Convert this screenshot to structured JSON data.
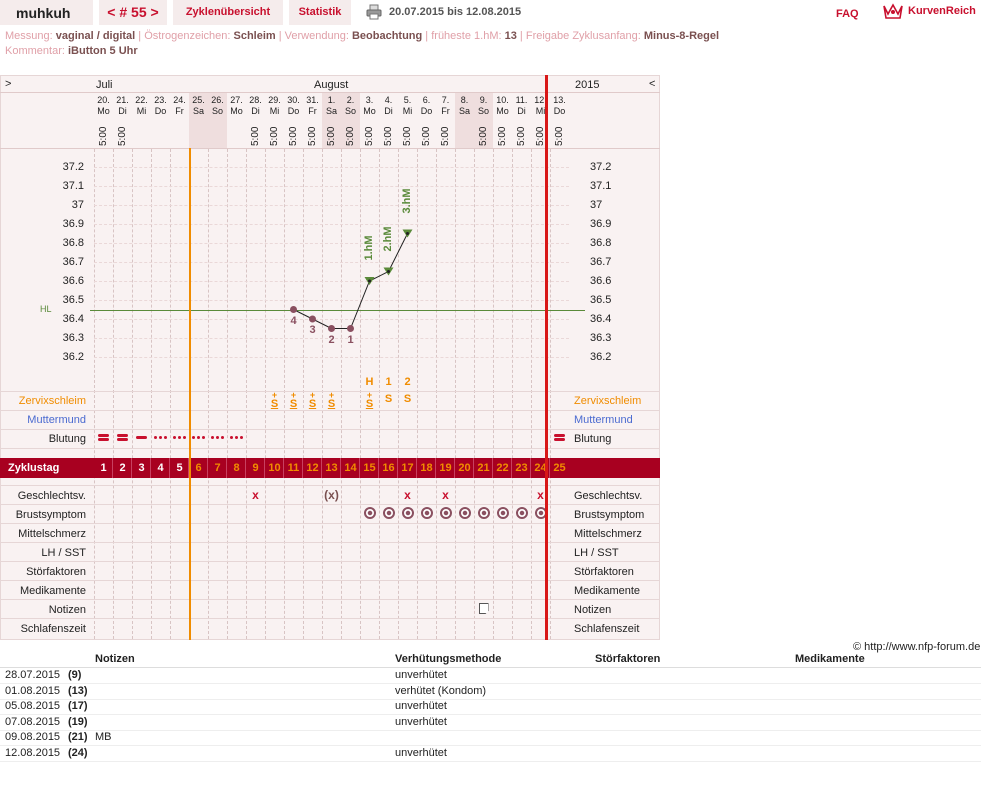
{
  "header": {
    "user": "muhkuh",
    "cycle": "< # 55 >",
    "tabs": [
      "Zyklenübersicht",
      "Statistik"
    ],
    "range": "20.07.2015 bis 12.08.2015",
    "faq": "FAQ",
    "logo": "KurvenReich"
  },
  "meta": {
    "line1": [
      {
        "label": "Messung:",
        "value": "vaginal / digital"
      },
      {
        "label": "Östrogenzeichen:",
        "value": "Schleim"
      },
      {
        "label": "Verwendung:",
        "value": "Beobachtung"
      },
      {
        "label": "früheste 1.hM:",
        "value": "13"
      },
      {
        "label": "Freigabe Zyklusanfang:",
        "value": "Minus-8-Regel"
      }
    ],
    "line2": [
      {
        "label": "Kommentar:",
        "value": "iButton 5 Uhr"
      }
    ]
  },
  "chart": {
    "nav_left": ">",
    "nav_right": "<",
    "year": "2015",
    "months": [
      {
        "name": "Juli"
      },
      {
        "name": "August"
      }
    ],
    "days": [
      {
        "d": "20.",
        "w": "Mo",
        "t": "5:00",
        "we": false
      },
      {
        "d": "21.",
        "w": "Di",
        "t": "5:00",
        "we": false
      },
      {
        "d": "22.",
        "w": "Mi",
        "t": "",
        "we": false
      },
      {
        "d": "23.",
        "w": "Do",
        "t": "",
        "we": false
      },
      {
        "d": "24.",
        "w": "Fr",
        "t": "",
        "we": false
      },
      {
        "d": "25.",
        "w": "Sa",
        "t": "",
        "we": true
      },
      {
        "d": "26.",
        "w": "So",
        "t": "",
        "we": true
      },
      {
        "d": "27.",
        "w": "Mo",
        "t": "",
        "we": false
      },
      {
        "d": "28.",
        "w": "Di",
        "t": "5:00",
        "we": false
      },
      {
        "d": "29.",
        "w": "Mi",
        "t": "5:00",
        "we": false
      },
      {
        "d": "30.",
        "w": "Do",
        "t": "5:00",
        "we": false
      },
      {
        "d": "31.",
        "w": "Fr",
        "t": "5:00",
        "we": false
      },
      {
        "d": "1.",
        "w": "Sa",
        "t": "5:00",
        "we": true
      },
      {
        "d": "2.",
        "w": "So",
        "t": "5:00",
        "we": true
      },
      {
        "d": "3.",
        "w": "Mo",
        "t": "5:00",
        "we": false
      },
      {
        "d": "4.",
        "w": "Di",
        "t": "5:00",
        "we": false
      },
      {
        "d": "5.",
        "w": "Mi",
        "t": "5:00",
        "we": false
      },
      {
        "d": "6.",
        "w": "Do",
        "t": "5:00",
        "we": false
      },
      {
        "d": "7.",
        "w": "Fr",
        "t": "5:00",
        "we": false
      },
      {
        "d": "8.",
        "w": "Sa",
        "t": "",
        "we": true
      },
      {
        "d": "9.",
        "w": "So",
        "t": "5:00",
        "we": true
      },
      {
        "d": "10.",
        "w": "Mo",
        "t": "5:00",
        "we": false
      },
      {
        "d": "11.",
        "w": "Di",
        "t": "5:00",
        "we": false
      },
      {
        "d": "12.",
        "w": "Mi",
        "t": "5:00",
        "we": false
      },
      {
        "d": "13.",
        "w": "Do",
        "t": "5:00",
        "we": false
      }
    ],
    "y_ticks": [
      "37.2",
      "37.1",
      "37",
      "36.9",
      "36.8",
      "36.7",
      "36.6",
      "36.5",
      "36.4",
      "36.3",
      "36.2"
    ],
    "hl_label": "HL",
    "hl_value": 36.45,
    "temps": [
      {
        "day": 11,
        "v": 36.45,
        "low": "4"
      },
      {
        "day": 12,
        "v": 36.4,
        "low": "3"
      },
      {
        "day": 13,
        "v": 36.35,
        "low": "2"
      },
      {
        "day": 14,
        "v": 36.35,
        "low": "1"
      },
      {
        "day": 15,
        "v": 36.6,
        "high": "1.hM"
      },
      {
        "day": 16,
        "v": 36.65,
        "high": "2.hM"
      },
      {
        "day": 17,
        "v": 36.85,
        "high": "3.hM"
      }
    ],
    "peak_marks": [
      {
        "day": 15,
        "t": "H"
      },
      {
        "day": 16,
        "t": "1"
      },
      {
        "day": 17,
        "t": "2"
      }
    ],
    "schleim": [
      {
        "day": 10,
        "t": "S",
        "plus": true
      },
      {
        "day": 11,
        "t": "S",
        "plus": true
      },
      {
        "day": 12,
        "t": "S",
        "plus": true
      },
      {
        "day": 13,
        "t": "S",
        "plus": true
      },
      {
        "day": 15,
        "t": "S",
        "plus": true
      },
      {
        "day": 16,
        "t": "S",
        "plus": false
      },
      {
        "day": 17,
        "t": "S",
        "plus": false
      }
    ],
    "bleeding": [
      {
        "day": 1,
        "k": "heavy"
      },
      {
        "day": 2,
        "k": "heavy"
      },
      {
        "day": 3,
        "k": "medium"
      },
      {
        "day": 4,
        "k": "light"
      },
      {
        "day": 5,
        "k": "light"
      },
      {
        "day": 6,
        "k": "light"
      },
      {
        "day": 7,
        "k": "light"
      },
      {
        "day": 8,
        "k": "light"
      },
      {
        "day": 25,
        "k": "heavy"
      }
    ],
    "cycle_label": "Zyklustag",
    "cycle_days": [
      "1",
      "2",
      "3",
      "4",
      "5",
      "6",
      "7",
      "8",
      "9",
      "10",
      "11",
      "12",
      "13",
      "14",
      "15",
      "16",
      "17",
      "18",
      "19",
      "20",
      "21",
      "22",
      "23",
      "24",
      "25"
    ],
    "upper_rows": [
      "Zervixschleim",
      "Muttermund",
      "Blutung"
    ],
    "lower_rows": [
      "Geschlechtsv.",
      "Brustsymptom",
      "Mittelschmerz",
      "LH / SST",
      "Störfaktoren",
      "Medikamente",
      "Notizen",
      "Schlafenszeit"
    ],
    "gv": [
      {
        "day": 9,
        "k": "x"
      },
      {
        "day": 13,
        "k": "(x)"
      },
      {
        "day": 17,
        "k": "x"
      },
      {
        "day": 19,
        "k": "x"
      },
      {
        "day": 24,
        "k": "x"
      }
    ],
    "breast_days": [
      15,
      16,
      17,
      18,
      19,
      20,
      21,
      22,
      23,
      24
    ],
    "note_days": [
      21
    ],
    "colors": {
      "accent": "#c8102e",
      "orange": "#f08c00",
      "green": "#5a8a3a",
      "bar": "#a80020",
      "pink": "#f7eeee",
      "weekend": "#efdede",
      "temp": "#8a5060"
    }
  },
  "copyright": "© http://www.nfp-forum.de",
  "notes": {
    "headers": [
      "Notizen",
      "Verhütungsmethode",
      "Störfaktoren",
      "Medikamente"
    ],
    "rows": [
      {
        "date": "28.07.2015",
        "day": "(9)",
        "note": "",
        "method": "unverhütet"
      },
      {
        "date": "01.08.2015",
        "day": "(13)",
        "note": "",
        "method": "verhütet (Kondom)"
      },
      {
        "date": "05.08.2015",
        "day": "(17)",
        "note": "",
        "method": "unverhütet"
      },
      {
        "date": "07.08.2015",
        "day": "(19)",
        "note": "",
        "method": "unverhütet"
      },
      {
        "date": "09.08.2015",
        "day": "(21)",
        "note": "MB",
        "method": ""
      },
      {
        "date": "12.08.2015",
        "day": "(24)",
        "note": "",
        "method": "unverhütet"
      }
    ]
  }
}
